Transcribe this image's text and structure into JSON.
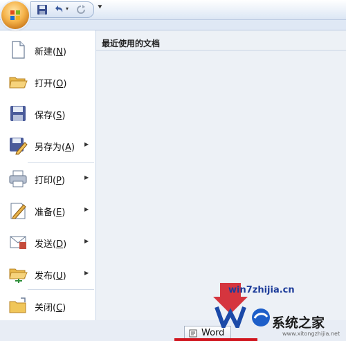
{
  "menu": {
    "items": [
      {
        "key": "new",
        "text": "新建(",
        "mnemonic": "N",
        "close": ")",
        "icon": "new-document-icon",
        "submenu": false
      },
      {
        "key": "open",
        "text": "打开(",
        "mnemonic": "O",
        "close": ")",
        "icon": "open-folder-icon",
        "submenu": false
      },
      {
        "key": "save",
        "text": "保存(",
        "mnemonic": "S",
        "close": ")",
        "icon": "save-disk-icon",
        "submenu": false
      },
      {
        "key": "saveas",
        "text": "另存为(",
        "mnemonic": "A",
        "close": ")",
        "icon": "save-as-icon",
        "submenu": true
      },
      {
        "key": "print",
        "text": "打印(",
        "mnemonic": "P",
        "close": ")",
        "icon": "printer-icon",
        "submenu": true
      },
      {
        "key": "prepare",
        "text": "准备(",
        "mnemonic": "E",
        "close": ")",
        "icon": "prepare-pen-icon",
        "submenu": true
      },
      {
        "key": "send",
        "text": "发送(",
        "mnemonic": "D",
        "close": ")",
        "icon": "send-mail-icon",
        "submenu": true
      },
      {
        "key": "publish",
        "text": "发布(",
        "mnemonic": "U",
        "close": ")",
        "icon": "publish-folder-icon",
        "submenu": true
      },
      {
        "key": "close",
        "text": "关闭(",
        "mnemonic": "C",
        "close": ")",
        "icon": "close-folder-icon",
        "submenu": false
      }
    ]
  },
  "recent": {
    "title": "最近使用的文档"
  },
  "taskbar": {
    "word_label": "Word"
  },
  "watermark": {
    "site": "win7zhijia.cn",
    "brand": "系统之家",
    "url": "www.xitongzhijia.net"
  },
  "colors": {
    "accent": "#1d3c9a",
    "orb": "#f5b34a",
    "highlight": "#d0141d"
  }
}
